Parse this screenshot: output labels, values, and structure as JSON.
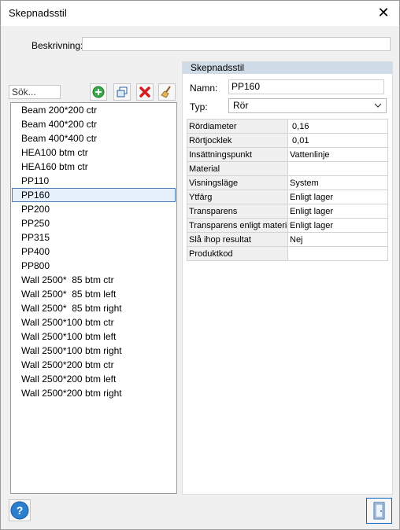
{
  "window": {
    "title": "Skepnadsstil",
    "close_glyph": "✕"
  },
  "description": {
    "label": "Beskrivning:",
    "value": ""
  },
  "search": {
    "placeholder": "Sök..."
  },
  "toolbar": {
    "buttons": [
      "add-icon",
      "copy-icon",
      "delete-icon",
      "broom-icon"
    ]
  },
  "styles_list": {
    "selected": "PP160",
    "items": [
      "Beam 200*200 ctr",
      "Beam 400*200 ctr",
      "Beam 400*400 ctr",
      "HEA100 btm ctr",
      "HEA160 btm ctr",
      "PP110",
      "PP160",
      "PP200",
      "PP250",
      "PP315",
      "PP400",
      "PP800",
      "Wall 2500*  85 btm ctr",
      "Wall 2500*  85 btm left",
      "Wall 2500*  85 btm right",
      "Wall 2500*100 btm ctr",
      "Wall 2500*100 btm left",
      "Wall 2500*100 btm right",
      "Wall 2500*200 btm ctr",
      "Wall 2500*200 btm left",
      "Wall 2500*200 btm right"
    ]
  },
  "panel": {
    "title": "Skepnadsstil",
    "name_label": "Namn:",
    "name_value": "PP160",
    "type_label": "Typ:",
    "type_value": "Rör",
    "properties": [
      {
        "key": "Rördiameter",
        "value": " 0,16"
      },
      {
        "key": "Rörtjocklek",
        "value": " 0,01"
      },
      {
        "key": "Insättningspunkt",
        "value": "Vattenlinje"
      },
      {
        "key": "Material",
        "value": ""
      },
      {
        "key": "Visningsläge",
        "value": "System"
      },
      {
        "key": "Ytfärg",
        "value": "Enligt lager"
      },
      {
        "key": "Transparens",
        "value": "Enligt lager"
      },
      {
        "key": "Transparens enligt material",
        "value": "Enligt lager"
      },
      {
        "key": "Slå ihop resultat",
        "value": "Nej"
      },
      {
        "key": "Produktkod",
        "value": ""
      }
    ]
  },
  "colors": {
    "selection_bg": "#e5f0fb",
    "selection_border": "#4a7bbd",
    "panel_header": "#cfdbe6"
  }
}
